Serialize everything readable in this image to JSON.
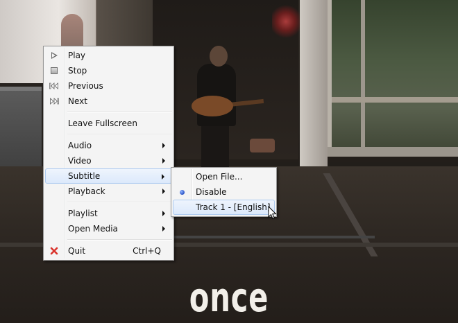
{
  "video": {
    "caption": "once"
  },
  "context_menu": {
    "items": [
      {
        "label": "Play",
        "icon": "play-icon"
      },
      {
        "label": "Stop",
        "icon": "stop-icon"
      },
      {
        "label": "Previous",
        "icon": "previous-icon"
      },
      {
        "label": "Next",
        "icon": "next-icon"
      },
      {
        "label": "Leave Fullscreen"
      },
      {
        "label": "Audio",
        "submenu": true
      },
      {
        "label": "Video",
        "submenu": true
      },
      {
        "label": "Subtitle",
        "submenu": true,
        "highlighted": true
      },
      {
        "label": "Playback",
        "submenu": true
      },
      {
        "label": "Playlist",
        "submenu": true
      },
      {
        "label": "Open Media",
        "submenu": true
      },
      {
        "label": "Quit",
        "icon": "quit-icon",
        "shortcut": "Ctrl+Q"
      }
    ]
  },
  "subtitle_menu": {
    "items": [
      {
        "label": "Open File..."
      },
      {
        "label": "Disable",
        "selected": true
      },
      {
        "label": "Track 1 - [English]",
        "highlighted": true
      }
    ]
  },
  "colors": {
    "menu_bg": "#f4f4f4",
    "highlight_bg": "#dce9fb",
    "highlight_border": "#aecbf0",
    "quit_icon": "#d9322b",
    "radio_dot": "#2a52c4"
  }
}
